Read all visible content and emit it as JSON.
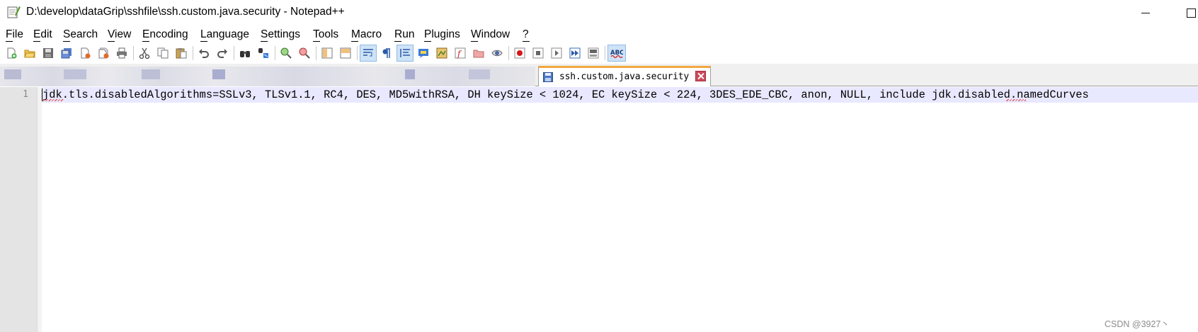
{
  "window": {
    "title": "D:\\develop\\dataGrip\\sshfile\\ssh.custom.java.security - Notepad++"
  },
  "menu": [
    "File",
    "Edit",
    "Search",
    "View",
    "Encoding",
    "Language",
    "Settings",
    "Tools",
    "Macro",
    "Run",
    "Plugins",
    "Window",
    "?"
  ],
  "toolbar": {
    "icons": [
      "new-file",
      "open-file",
      "save",
      "save-all",
      "close",
      "close-all",
      "print",
      "cut",
      "copy",
      "paste",
      "undo",
      "redo",
      "find",
      "replace",
      "zoom-in",
      "zoom-out",
      "sync-vertical",
      "sync-horizontal",
      "word-wrap",
      "show-all-characters",
      "indent-guide",
      "user-defined-language",
      "document-map",
      "function-list",
      "folder-as-workspace",
      "monitoring",
      "record-macro",
      "stop-recording",
      "play-macro",
      "run-macro-multiple",
      "save-macro",
      "spell-check"
    ]
  },
  "tabs": [
    {
      "label": "ssh.custom.java.security",
      "active": true
    }
  ],
  "editor": {
    "lines": [
      {
        "number": "1",
        "text": "jdk.tls.disabledAlgorithms=SSLv3, TLSv1.1, RC4, DES, MD5withRSA, DH keySize < 1024, EC keySize < 224, 3DES_EDE_CBC, anon, NULL, include jdk.disabled.namedCurves"
      }
    ]
  },
  "watermark": "CSDN @3927丶",
  "colors": {
    "active_tab_accent": "#f3a741",
    "current_line_bg": "#e8e8ff",
    "gutter_bg": "#e4e4e4",
    "spell_error": "#e03030",
    "close_button": "#ca4a5c"
  }
}
